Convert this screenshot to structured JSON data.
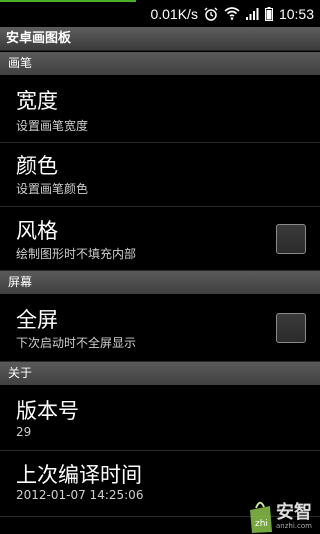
{
  "status_bar": {
    "net_speed": "0.01K/s",
    "time": "10:53",
    "icons": [
      "alarm-icon",
      "wifi-icon",
      "signal-icon",
      "battery-icon"
    ]
  },
  "app": {
    "title": "安卓画图板"
  },
  "sections": {
    "brush": {
      "header": "画笔"
    },
    "screen": {
      "header": "屏幕"
    },
    "about": {
      "header": "关于"
    }
  },
  "prefs": {
    "width": {
      "title": "宽度",
      "summary": "设置画笔宽度"
    },
    "color": {
      "title": "颜色",
      "summary": "设置画笔颜色"
    },
    "style": {
      "title": "风格",
      "summary": "绘制图形时不填充内部",
      "checked": false
    },
    "fullscreen": {
      "title": "全屏",
      "summary": "下次启动时不全屏显示",
      "checked": false
    },
    "version": {
      "title": "版本号",
      "summary": "29"
    },
    "compile_time": {
      "title": "上次编译时间",
      "summary": "2012-01-07 14:25:06"
    }
  },
  "watermark": {
    "text": "安智",
    "subtext": "anzhi.com"
  },
  "colors": {
    "accent_green": "#4caf2a",
    "section_bg": "#4a4a4a"
  }
}
